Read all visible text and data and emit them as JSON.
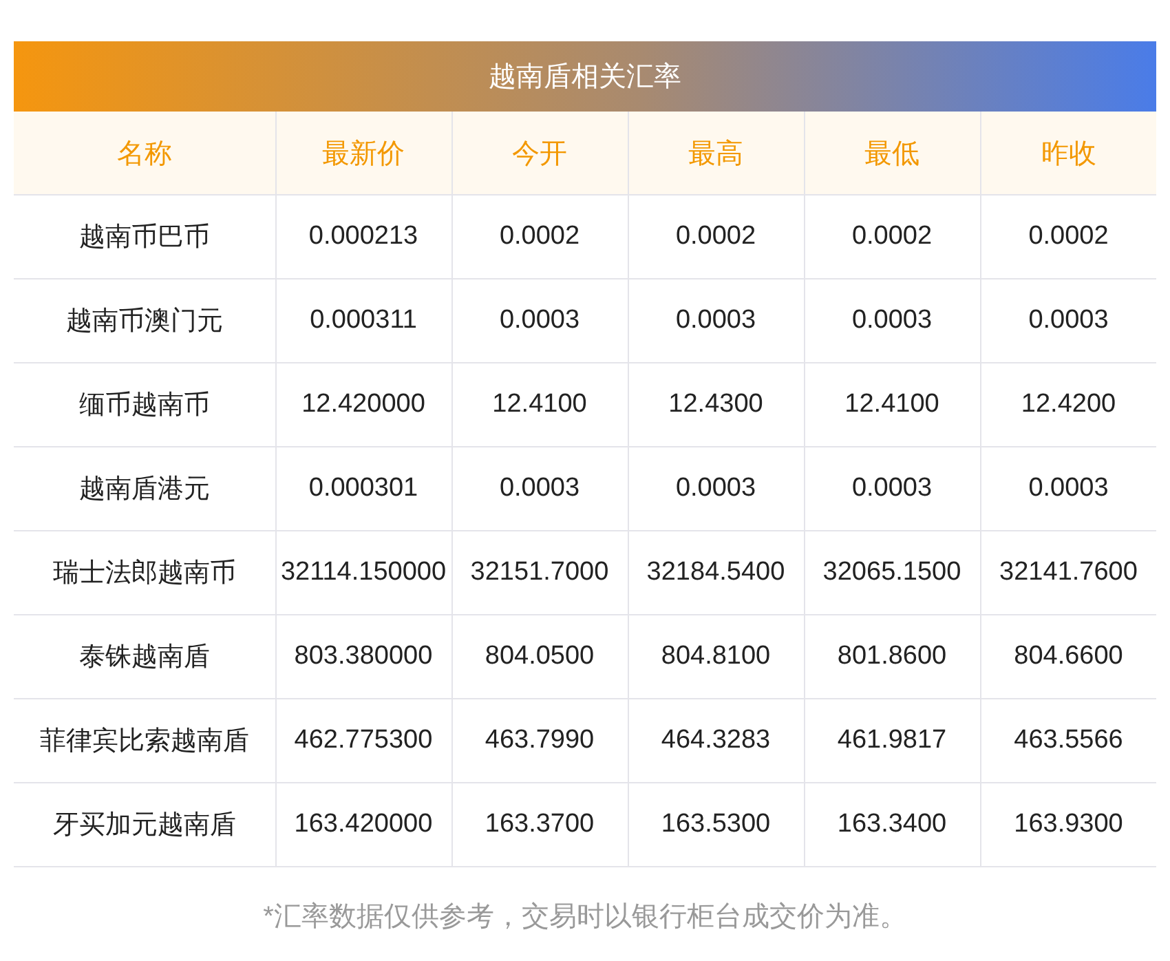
{
  "title": "越南盾相关汇率",
  "table": {
    "columns": [
      "名称",
      "最新价",
      "今开",
      "最高",
      "最低",
      "昨收"
    ],
    "rows": [
      [
        "越南币巴币",
        "0.000213",
        "0.0002",
        "0.0002",
        "0.0002",
        "0.0002"
      ],
      [
        "越南币澳门元",
        "0.000311",
        "0.0003",
        "0.0003",
        "0.0003",
        "0.0003"
      ],
      [
        "缅币越南币",
        "12.420000",
        "12.4100",
        "12.4300",
        "12.4100",
        "12.4200"
      ],
      [
        "越南盾港元",
        "0.000301",
        "0.0003",
        "0.0003",
        "0.0003",
        "0.0003"
      ],
      [
        "瑞士法郎越南币",
        "32114.150000",
        "32151.7000",
        "32184.5400",
        "32065.1500",
        "32141.7600"
      ],
      [
        "泰铢越南盾",
        "803.380000",
        "804.0500",
        "804.8100",
        "801.8600",
        "804.6600"
      ],
      [
        "菲律宾比索越南盾",
        "462.775300",
        "463.7990",
        "464.3283",
        "461.9817",
        "463.5566"
      ],
      [
        "牙买加元越南盾",
        "163.420000",
        "163.3700",
        "163.5300",
        "163.3400",
        "163.9300"
      ]
    ]
  },
  "footnote": "*汇率数据仅供参考，交易时以银行柜台成交价为准。"
}
